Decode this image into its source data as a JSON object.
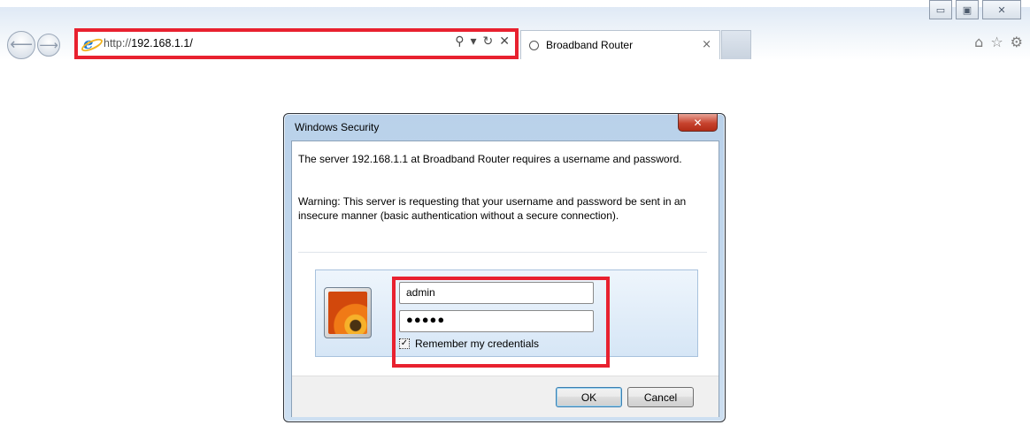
{
  "browser": {
    "address": {
      "scheme": "http://",
      "host": "192.168.1.1/"
    },
    "tab": {
      "title": "Broadband Router",
      "close": "×"
    },
    "nav": {
      "back": "⟵",
      "forward": "⟶"
    },
    "addr_tools": {
      "search": "⚲",
      "dropdown": "▾",
      "refresh": "↻",
      "stop": "✕"
    },
    "window_controls": {
      "minimize": "▭",
      "maximize": "▣",
      "close": "✕"
    },
    "command_icons": {
      "home": "⌂",
      "favorites": "☆",
      "tools": "⚙"
    }
  },
  "dialog": {
    "title": "Windows Security",
    "close_glyph": "✕",
    "message": "The server 192.168.1.1 at Broadband Router requires a username and password.",
    "warning": "Warning: This server is requesting that your username and password be sent in an insecure manner (basic authentication without a secure connection).",
    "username": "admin",
    "password_mask": "●●●●●",
    "remember_label": "Remember my credentials",
    "remember_checked": "✓",
    "ok_label": "OK",
    "cancel_label": "Cancel"
  },
  "colors": {
    "highlight": "#e8212f",
    "dialog_frame": "#b9d1ea",
    "close_button": "#c7432e"
  }
}
